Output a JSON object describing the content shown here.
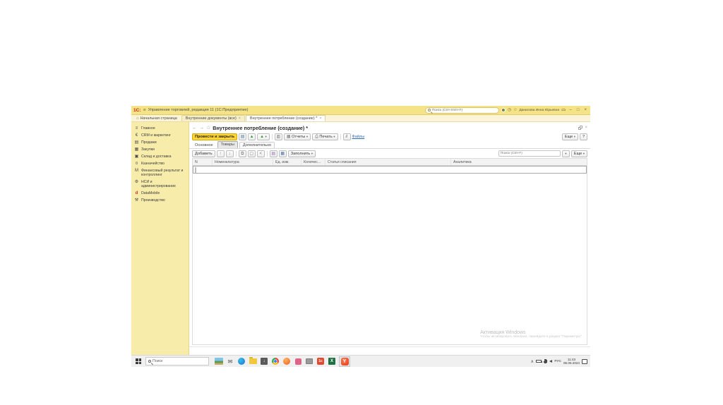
{
  "titlebar": {
    "logo": "1С:",
    "menu_glyph": "≡",
    "title": "Управление торговлей, редакция 11 (1С:Предприятие)",
    "search_placeholder": "Поиск (Ctrl+Shift+F)",
    "clock_glyph": "◷",
    "star_glyph": "☆",
    "user": "Данилова Инна Юрьевна",
    "minimize": "–",
    "maximize": "□",
    "close": "×"
  },
  "app_tabs": {
    "home_icon": "⌂",
    "home_label": "Начальная страница",
    "tab_documents": "Внутренние документы (все)",
    "tab_consumption": "Внутреннее потребление (создание) *",
    "close_glyph": "×"
  },
  "sidebar": {
    "items": [
      {
        "icon": "≡",
        "label": "Главное"
      },
      {
        "icon": "€",
        "label": "CRM и маркетинг"
      },
      {
        "icon": "▤",
        "label": "Продажи"
      },
      {
        "icon": "▦",
        "label": "Закупки"
      },
      {
        "icon": "▣",
        "label": "Склад и доставка"
      },
      {
        "icon": "¤",
        "label": "Казначейство"
      },
      {
        "icon": "M",
        "label": "Финансовый результат и контроллинг"
      },
      {
        "icon": "⚙",
        "label": "НСИ и администрирование"
      },
      {
        "icon": "d",
        "label": "DataMobile"
      },
      {
        "icon": "⚒",
        "label": "Производство"
      }
    ]
  },
  "document": {
    "back": "←",
    "forward": "→",
    "star": "☆",
    "title": "Внутреннее потребление (создание) *",
    "toolbar": {
      "post_and_close": "Провести и закрыть",
      "save_icon": "▤",
      "post_icon": "▲",
      "create_based_icon": "▲",
      "structure_icon": "▥",
      "reports": "Отчеты",
      "reports_icon": "▦",
      "print": "Печать",
      "print_icon": "⎙",
      "paperclip_icon": "∂",
      "files": "Файлы",
      "more": "Еще",
      "help": "?",
      "dropdown": "▾"
    },
    "tabs": {
      "main": "Основное",
      "goods": "Товары",
      "extra": "Дополнительно"
    },
    "table_toolbar": {
      "add": "Добавить",
      "up": "↑",
      "down": "↓",
      "copy_icon": "⧉",
      "delete_icon": "▢",
      "share_icon": "<",
      "card_icon": "▤",
      "fill_icon": "▦",
      "fill": "Заполнить",
      "search_placeholder": "Поиск (Ctrl+F)",
      "search_caret": "▾",
      "more": "Еще",
      "dropdown": "▾"
    },
    "table": {
      "columns": {
        "num": "N",
        "nomenclature": "Номенклатура",
        "unit": "Ед. изм.",
        "qty": "Количес...",
        "expense_item": "Статья списания",
        "analytics": "Аналитика"
      }
    },
    "watermark": {
      "title": "Активация Windows",
      "subtitle": "Чтобы активировать Windows, перейдите в раздел \"Параметры\"."
    }
  },
  "taskbar": {
    "search_placeholder": "Поиск",
    "icons": [
      "photo-thumbnail",
      "mail",
      "edge",
      "folder",
      "downloads",
      "chrome",
      "browser-orange",
      "media-pink",
      "explorer",
      "app-red-1c",
      "excel",
      "yandex-browser-active"
    ],
    "excel_letter": "X",
    "onec_label": "1с",
    "yandex_letter": "Y",
    "tray_chevron": "∧",
    "lang": "РУС",
    "time": "11:43",
    "date": "06.05.2024"
  }
}
